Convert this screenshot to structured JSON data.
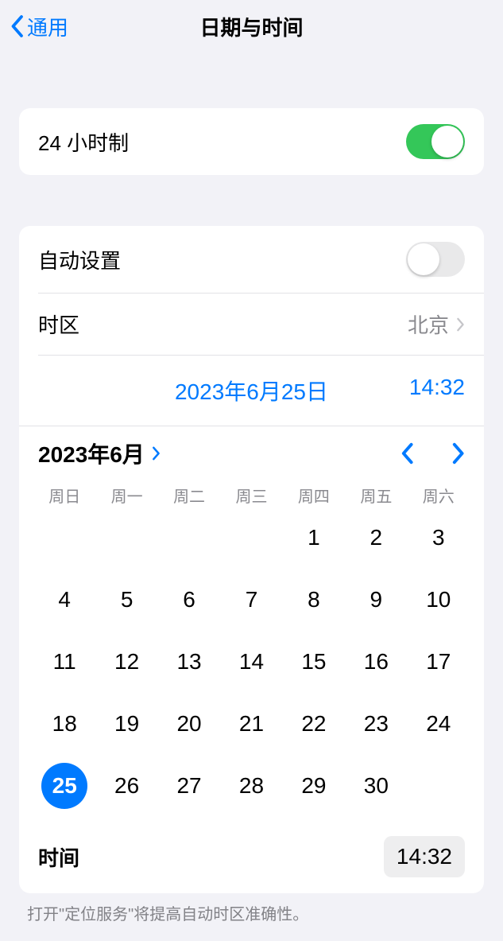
{
  "nav": {
    "back_label": "通用",
    "title": "日期与时间"
  },
  "hour24": {
    "label": "24 小时制",
    "on": true
  },
  "auto": {
    "label": "自动设置",
    "on": false
  },
  "timezone": {
    "label": "时区",
    "value": "北京"
  },
  "selected": {
    "date": "2023年6月25日",
    "time": "14:32"
  },
  "calendar": {
    "month_label": "2023年6月",
    "weekdays": [
      "周日",
      "周一",
      "周二",
      "周三",
      "周四",
      "周五",
      "周六"
    ],
    "first_weekday_index": 4,
    "days_in_month": 30,
    "selected_day": 25
  },
  "time_row": {
    "label": "时间",
    "value": "14:32"
  },
  "footer": "打开\"定位服务\"将提高自动时区准确性。"
}
